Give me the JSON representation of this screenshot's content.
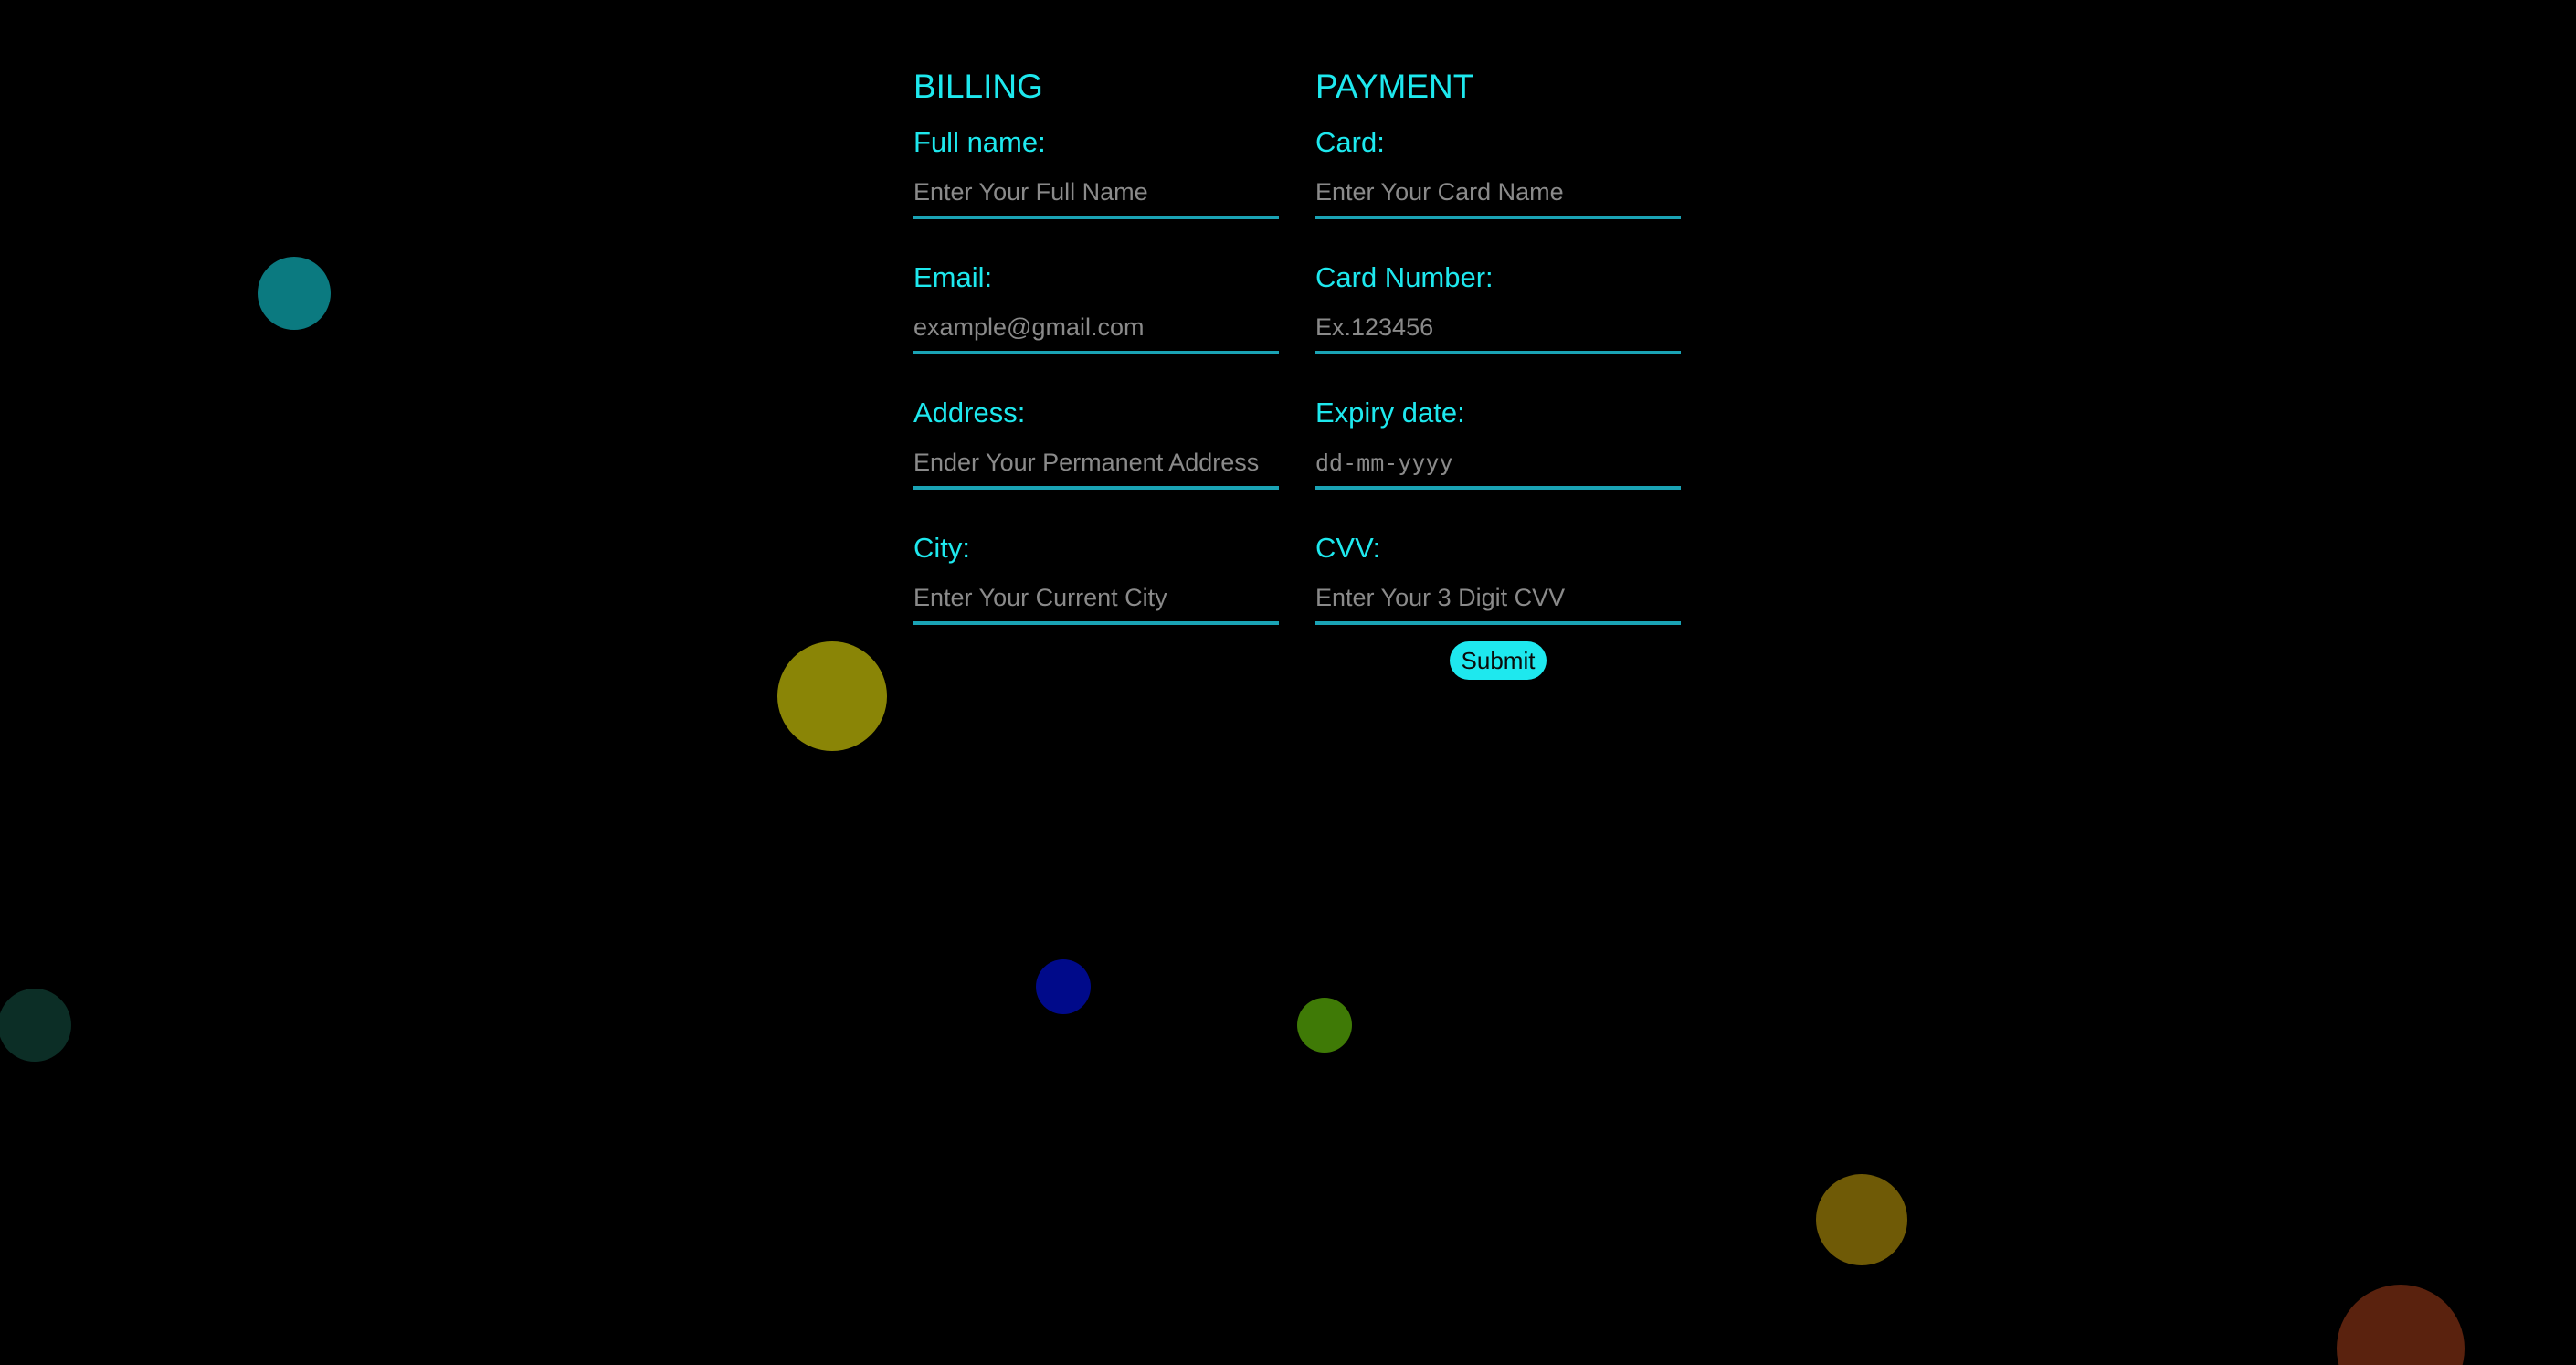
{
  "colors": {
    "background": "#000000",
    "accent": "#1ee8ee",
    "input_underline": "#1aa3b5",
    "placeholder": "#8a8a8a",
    "bubbles": [
      "#0b7a80",
      "#8a8506",
      "#0c2e26",
      "#000a8a",
      "#3f7a06",
      "#6f5a06",
      "#5a220e"
    ]
  },
  "billing": {
    "title": "BILLING",
    "full_name": {
      "label": "Full name:",
      "placeholder": "Enter Your Full Name"
    },
    "email": {
      "label": "Email:",
      "placeholder": "example@gmail.com"
    },
    "address": {
      "label": "Address:",
      "placeholder": "Ender Your Permanent Address"
    },
    "city": {
      "label": "City:",
      "placeholder": "Enter Your Current City"
    }
  },
  "payment": {
    "title": "PAYMENT",
    "card": {
      "label": "Card:",
      "placeholder": "Enter Your Card Name"
    },
    "card_number": {
      "label": "Card Number:",
      "placeholder": "Ex.123456"
    },
    "expiry": {
      "label": "Expiry date:",
      "placeholder": "dd-mm-yyyy"
    },
    "cvv": {
      "label": "CVV:",
      "placeholder": "Enter Your 3 Digit CVV"
    },
    "submit_label": "Submit"
  }
}
